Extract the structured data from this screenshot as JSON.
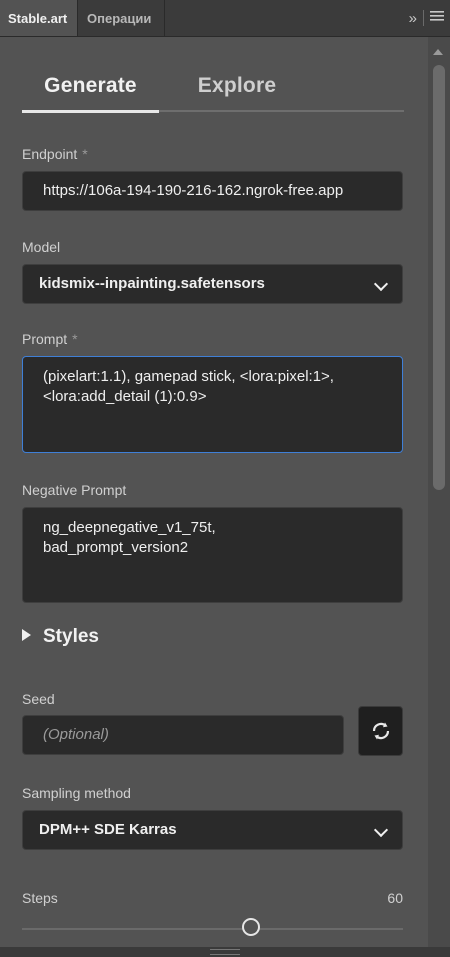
{
  "panel_tabs": {
    "active": "Stable.art",
    "inactive": "Операции"
  },
  "toolbar": {
    "collapse_icon": "double-chevron-right-icon",
    "menu_icon": "hamburger-menu-icon"
  },
  "main_tabs": [
    {
      "label": "Generate",
      "selected": true
    },
    {
      "label": "Explore",
      "selected": false
    }
  ],
  "endpoint": {
    "label": "Endpoint",
    "required_mark": "*",
    "value": "https://106a-194-190-216-162.ngrok-free.app"
  },
  "model": {
    "label": "Model",
    "value": "kidsmix--inpainting.safetensors"
  },
  "prompt": {
    "label": "Prompt",
    "required_mark": "*",
    "value": "(pixelart:1.1), gamepad stick, <lora:pixel:1>,\n<lora:add_detail (1):0.9>"
  },
  "negative_prompt": {
    "label": "Negative Prompt",
    "value": "ng_deepnegative_v1_75t,\nbad_prompt_version2"
  },
  "styles": {
    "label": "Styles"
  },
  "seed": {
    "label": "Seed",
    "placeholder": "(Optional)",
    "button_icon": "random-refresh-icon"
  },
  "sampling": {
    "label": "Sampling method",
    "value": "DPM++ SDE Karras"
  },
  "steps": {
    "label": "Steps",
    "value": "60",
    "slider_fraction": 0.6
  },
  "colors": {
    "focus": "#3f7fd6",
    "panel_bg": "#535353",
    "field_bg": "#2a2a2a"
  }
}
